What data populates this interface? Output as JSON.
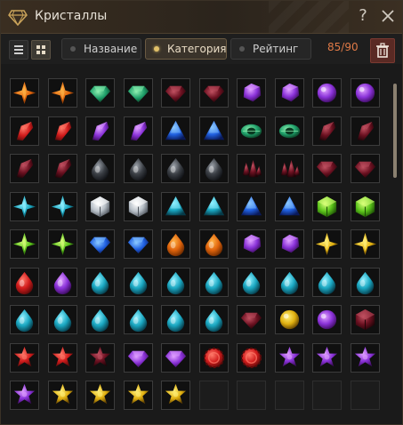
{
  "window": {
    "title": "Кристаллы",
    "help_icon": "question-icon",
    "close_icon": "close-icon"
  },
  "toolbar": {
    "sort_buttons": [
      {
        "label": "Название",
        "active": false
      },
      {
        "label": "Категория",
        "active": true
      },
      {
        "label": "Рейтинг",
        "active": false
      }
    ],
    "count": "85/90"
  },
  "palette": {
    "orange": [
      "#ffb347",
      "#e0640c",
      "#6b2a00"
    ],
    "red": [
      "#ff7a6a",
      "#d11c1c",
      "#5a0a0a"
    ],
    "green": [
      "#8ef0b0",
      "#1fa06a",
      "#0a3a22"
    ],
    "purple": [
      "#e0a0ff",
      "#8a32d8",
      "#3a0a5a"
    ],
    "darkred": [
      "#c05060",
      "#6a1020",
      "#1e0408"
    ],
    "blue": [
      "#8ac8ff",
      "#2060e0",
      "#0a1a5a"
    ],
    "teal": [
      "#90f0ff",
      "#1aa6c0",
      "#063a48"
    ],
    "silver": [
      "#ffffff",
      "#b8c0c8",
      "#4a5058"
    ],
    "lime": [
      "#d8ff7a",
      "#5ac21a",
      "#1a4a04"
    ],
    "gold": [
      "#fff07a",
      "#e0b010",
      "#5a3a00"
    ],
    "darkgray": [
      "#9aa0a8",
      "#3a3e44",
      "#101216"
    ]
  },
  "grid": {
    "columns": 10,
    "rows": [
      [
        [
          "orange",
          "spark"
        ],
        [
          "orange",
          "spark"
        ],
        [
          "green",
          "gem"
        ],
        [
          "green",
          "gem"
        ],
        [
          "darkred",
          "gem"
        ],
        [
          "darkred",
          "gem"
        ],
        [
          "purple",
          "flat"
        ],
        [
          "purple",
          "flat"
        ],
        [
          "purple",
          "orb"
        ],
        [
          "purple",
          "orb"
        ]
      ],
      [
        [
          "red",
          "shard"
        ],
        [
          "red",
          "shard"
        ],
        [
          "purple",
          "shard"
        ],
        [
          "purple",
          "shard"
        ],
        [
          "blue",
          "tri"
        ],
        [
          "blue",
          "tri"
        ],
        [
          "green",
          "eye"
        ],
        [
          "green",
          "eye"
        ],
        [
          "darkred",
          "shard"
        ],
        [
          "darkred",
          "shard"
        ]
      ],
      [
        [
          "darkred",
          "shard"
        ],
        [
          "darkred",
          "shard"
        ],
        [
          "darkgray",
          "drop"
        ],
        [
          "darkgray",
          "drop"
        ],
        [
          "darkgray",
          "drop"
        ],
        [
          "darkgray",
          "drop"
        ],
        [
          "darkred",
          "cluster"
        ],
        [
          "darkred",
          "cluster"
        ],
        [
          "darkred",
          "gem"
        ],
        [
          "darkred",
          "gem"
        ]
      ],
      [
        [
          "teal",
          "spark"
        ],
        [
          "teal",
          "spark"
        ],
        [
          "silver",
          "cube"
        ],
        [
          "silver",
          "cube"
        ],
        [
          "teal",
          "tri"
        ],
        [
          "teal",
          "tri"
        ],
        [
          "blue",
          "tri"
        ],
        [
          "blue",
          "tri"
        ],
        [
          "lime",
          "cube"
        ],
        [
          "lime",
          "cube"
        ]
      ],
      [
        [
          "lime",
          "spark"
        ],
        [
          "lime",
          "spark"
        ],
        [
          "blue",
          "gem"
        ],
        [
          "blue",
          "gem"
        ],
        [
          "orange",
          "drop"
        ],
        [
          "orange",
          "drop"
        ],
        [
          "purple",
          "flat"
        ],
        [
          "purple",
          "flat"
        ],
        [
          "gold",
          "spark"
        ],
        [
          "gold",
          "spark"
        ]
      ],
      [
        [
          "red",
          "drop"
        ],
        [
          "purple",
          "drop"
        ],
        [
          "teal",
          "drop"
        ],
        [
          "teal",
          "drop"
        ],
        [
          "teal",
          "drop"
        ],
        [
          "teal",
          "drop"
        ],
        [
          "teal",
          "drop"
        ],
        [
          "teal",
          "drop"
        ],
        [
          "teal",
          "drop"
        ],
        [
          "teal",
          "drop"
        ]
      ],
      [
        [
          "teal",
          "drop"
        ],
        [
          "teal",
          "drop"
        ],
        [
          "teal",
          "drop"
        ],
        [
          "teal",
          "drop"
        ],
        [
          "teal",
          "drop"
        ],
        [
          "teal",
          "drop"
        ],
        [
          "darkred",
          "gem"
        ],
        [
          "gold",
          "orb"
        ],
        [
          "purple",
          "orb"
        ],
        [
          "darkred",
          "cube"
        ]
      ],
      [
        [
          "red",
          "star"
        ],
        [
          "red",
          "star"
        ],
        [
          "darkred",
          "star"
        ],
        [
          "purple",
          "gem"
        ],
        [
          "purple",
          "gem"
        ],
        [
          "red",
          "ring"
        ],
        [
          "red",
          "ring"
        ],
        [
          "purple",
          "star"
        ],
        [
          "purple",
          "star"
        ],
        [
          "purple",
          "star"
        ]
      ],
      [
        [
          "purple",
          "star"
        ],
        [
          "gold",
          "star"
        ],
        [
          "gold",
          "star"
        ],
        [
          "gold",
          "star"
        ],
        [
          "gold",
          "star"
        ],
        null,
        null,
        null,
        null,
        null
      ]
    ]
  }
}
